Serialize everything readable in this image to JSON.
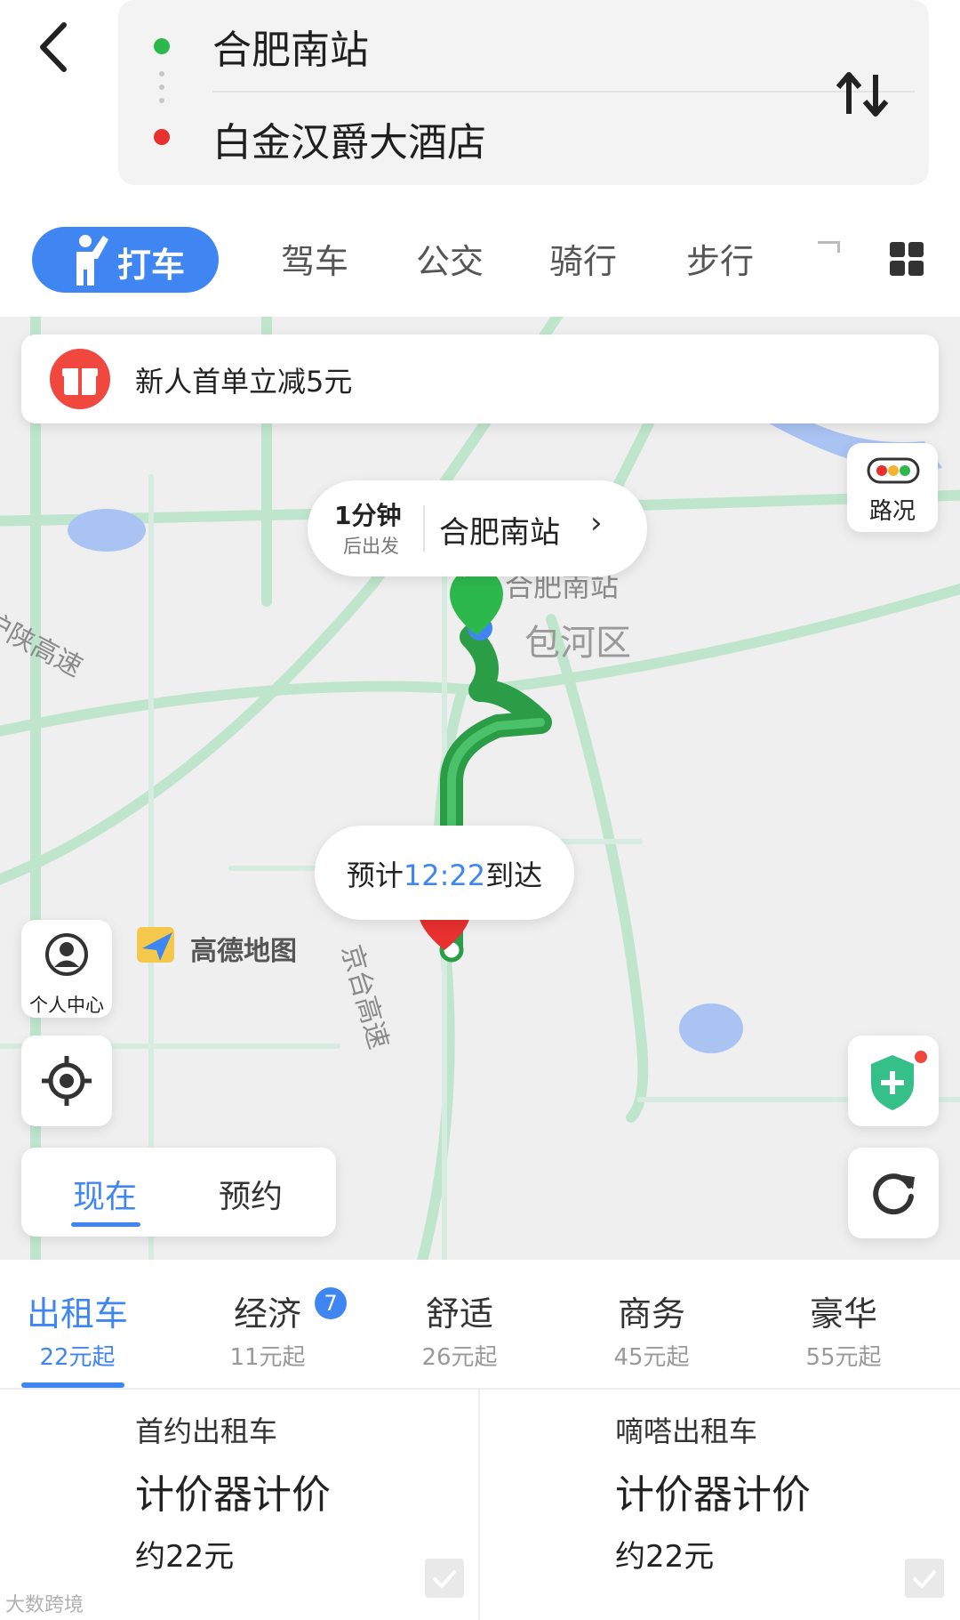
{
  "route": {
    "origin": "合肥南站",
    "destination": "白金汉爵大酒店"
  },
  "mode_tabs": [
    {
      "label": "打车",
      "active": true
    },
    {
      "label": "驾车",
      "active": false
    },
    {
      "label": "公交",
      "active": false
    },
    {
      "label": "骑行",
      "active": false
    },
    {
      "label": "步行",
      "active": false
    }
  ],
  "map": {
    "promo_text": "新人首单立减5元",
    "traffic_label": "路况",
    "depart_bubble": {
      "minutes": "1分钟",
      "subtitle": "后出发",
      "station": "合肥南站"
    },
    "eta": {
      "prefix": "预计",
      "time": "12:22",
      "suffix": "到达"
    },
    "start_marker": "起",
    "end_marker": "终",
    "labels": {
      "station": "合肥南站",
      "district": "包河区",
      "highway_west": "沪陕高速",
      "highway_south": "京台高速",
      "logo": "高德地图"
    },
    "profile_label": "个人中心",
    "time_options": [
      "现在",
      "预约"
    ]
  },
  "car_classes": [
    {
      "name": "出租车",
      "price": "22元起",
      "active": true
    },
    {
      "name": "经济",
      "price": "11元起",
      "badge": "7"
    },
    {
      "name": "舒适",
      "price": "26元起"
    },
    {
      "name": "商务",
      "price": "45元起"
    },
    {
      "name": "豪华",
      "price": "55元起"
    }
  ],
  "offers": [
    {
      "name": "首约出租车",
      "mode": "计价器计价",
      "price": "约22元"
    },
    {
      "name": "嘀嗒出租车",
      "mode": "计价器计价",
      "price": "约22元"
    }
  ],
  "watermark": "大数跨境",
  "colors": {
    "accent": "#3f86f2",
    "route": "#2a9d46",
    "start": "#2db84d",
    "end": "#e8302f"
  }
}
